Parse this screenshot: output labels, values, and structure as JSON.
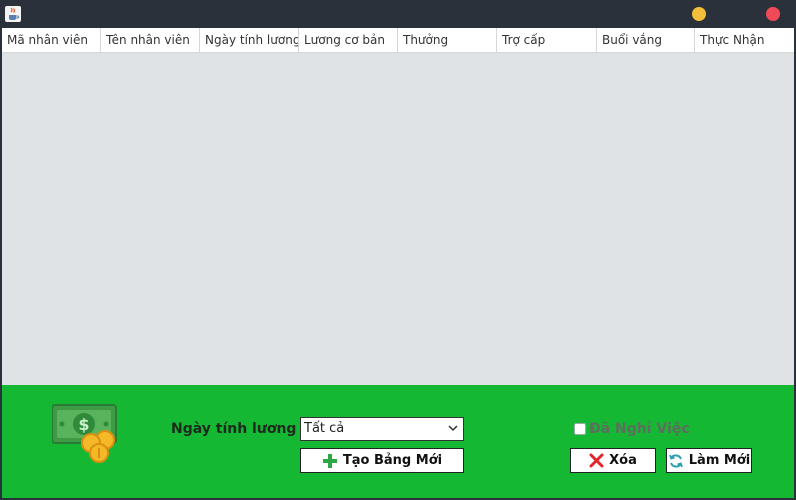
{
  "window": {
    "icon": "java-cup-icon",
    "controls": {
      "minimize_color": "#f3bf3a",
      "close_color": "#f04a58"
    }
  },
  "table": {
    "columns": [
      "Mã nhân viên",
      "Tên nhân viên",
      "Ngày tính lương",
      "Lương cơ bản",
      "Thưởng",
      "Trợ cấp",
      "Buổi vắng",
      "Thực Nhận"
    ],
    "rows": []
  },
  "filters": {
    "date_label": "Ngày tính lương",
    "date_select_value": "Tất cả",
    "quit_checkbox_label": "Đã Nghỉ Việc",
    "quit_checked": false
  },
  "actions": {
    "create_label": "Tạo Bảng Mới",
    "delete_label": "Xóa",
    "refresh_label": "Làm Mới"
  },
  "colors": {
    "panel_green": "#14b833",
    "table_bg": "#e0e3e6",
    "titlebar": "#2b313b"
  }
}
